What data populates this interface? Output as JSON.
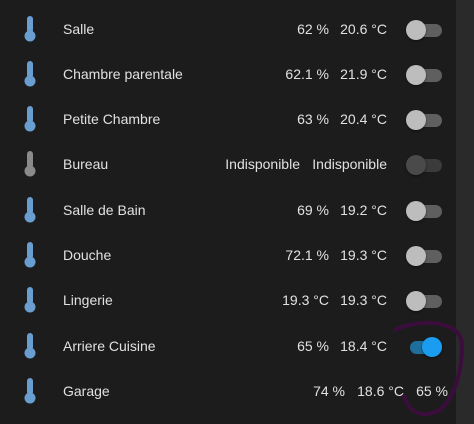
{
  "colors": {
    "background": "#1c1c1c",
    "icon_active": "#6a9ed0",
    "icon_unavailable": "#8a8a8a",
    "toggle_on": "#1a9cf0",
    "annotation": "#3b0d3d"
  },
  "rows": [
    {
      "name": "Salle",
      "humidity": "62 %",
      "temperature": "20.6 °C",
      "toggle": "off",
      "icon": "thermometer-icon"
    },
    {
      "name": "Chambre parentale",
      "humidity": "62.1 %",
      "temperature": "21.9 °C",
      "toggle": "off",
      "icon": "thermometer-icon"
    },
    {
      "name": "Petite Chambre",
      "humidity": "63 %",
      "temperature": "20.4 °C",
      "toggle": "off",
      "icon": "thermometer-icon"
    },
    {
      "name": "Bureau",
      "humidity": "Indisponible",
      "temperature": "Indisponible",
      "toggle": "unavailable",
      "icon": "thermometer-icon"
    },
    {
      "name": "Salle de Bain",
      "humidity": "69 %",
      "temperature": "19.2 °C",
      "toggle": "off",
      "icon": "thermometer-icon"
    },
    {
      "name": "Douche",
      "humidity": "72.1 %",
      "temperature": "19.3 °C",
      "toggle": "off",
      "icon": "thermometer-icon"
    },
    {
      "name": "Lingerie",
      "humidity": "19.3 °C",
      "temperature": "19.3 °C",
      "toggle": "off",
      "icon": "thermometer-icon"
    },
    {
      "name": "Arriere Cuisine",
      "humidity": "65 %",
      "temperature": "18.4 °C",
      "toggle": "on",
      "icon": "thermometer-icon"
    },
    {
      "name": "Garage",
      "humidity": "74 %",
      "temperature": "18.6 °C",
      "extra": "65 %",
      "icon": "thermometer-icon"
    }
  ]
}
